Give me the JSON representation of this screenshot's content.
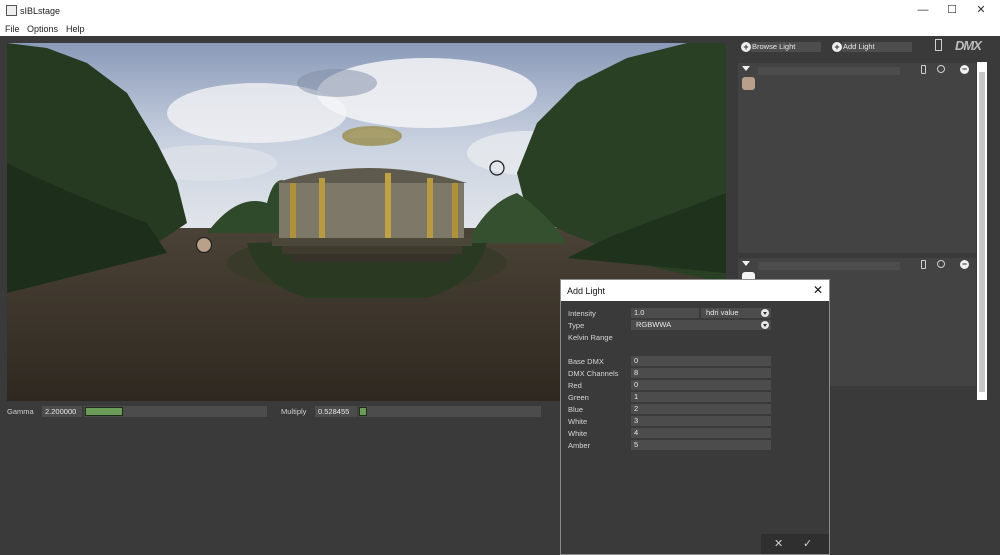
{
  "window": {
    "title": "sIBLstage",
    "controls": [
      "—",
      "☐",
      "✕"
    ]
  },
  "menu": [
    "File",
    "Options",
    "Help"
  ],
  "bottom": {
    "gamma_label": "Gamma",
    "gamma_value": "2.200000",
    "multiply_label": "Multiply",
    "multiply_value": "0.528455"
  },
  "right": {
    "browse_light": "Browse Light",
    "add_light": "Add Light",
    "logo": "DMX"
  },
  "dialog": {
    "title": "Add Light",
    "close": "✕",
    "intensity_label": "Intensity",
    "intensity_value": "1.0",
    "intensity_mode": "hdri value",
    "type_label": "Type",
    "type_value": "RGBWWA",
    "kelvin_label": "Kelvin Range",
    "rows": [
      {
        "label": "Base DMX",
        "value": "0"
      },
      {
        "label": "DMX Channels",
        "value": "8"
      },
      {
        "label": "Red",
        "value": "0"
      },
      {
        "label": "Green",
        "value": "1"
      },
      {
        "label": "Blue",
        "value": "2"
      },
      {
        "label": "White",
        "value": "3"
      },
      {
        "label": "White",
        "value": "4"
      },
      {
        "label": "Amber",
        "value": "5"
      }
    ],
    "cancel": "✕",
    "confirm": "✓"
  }
}
